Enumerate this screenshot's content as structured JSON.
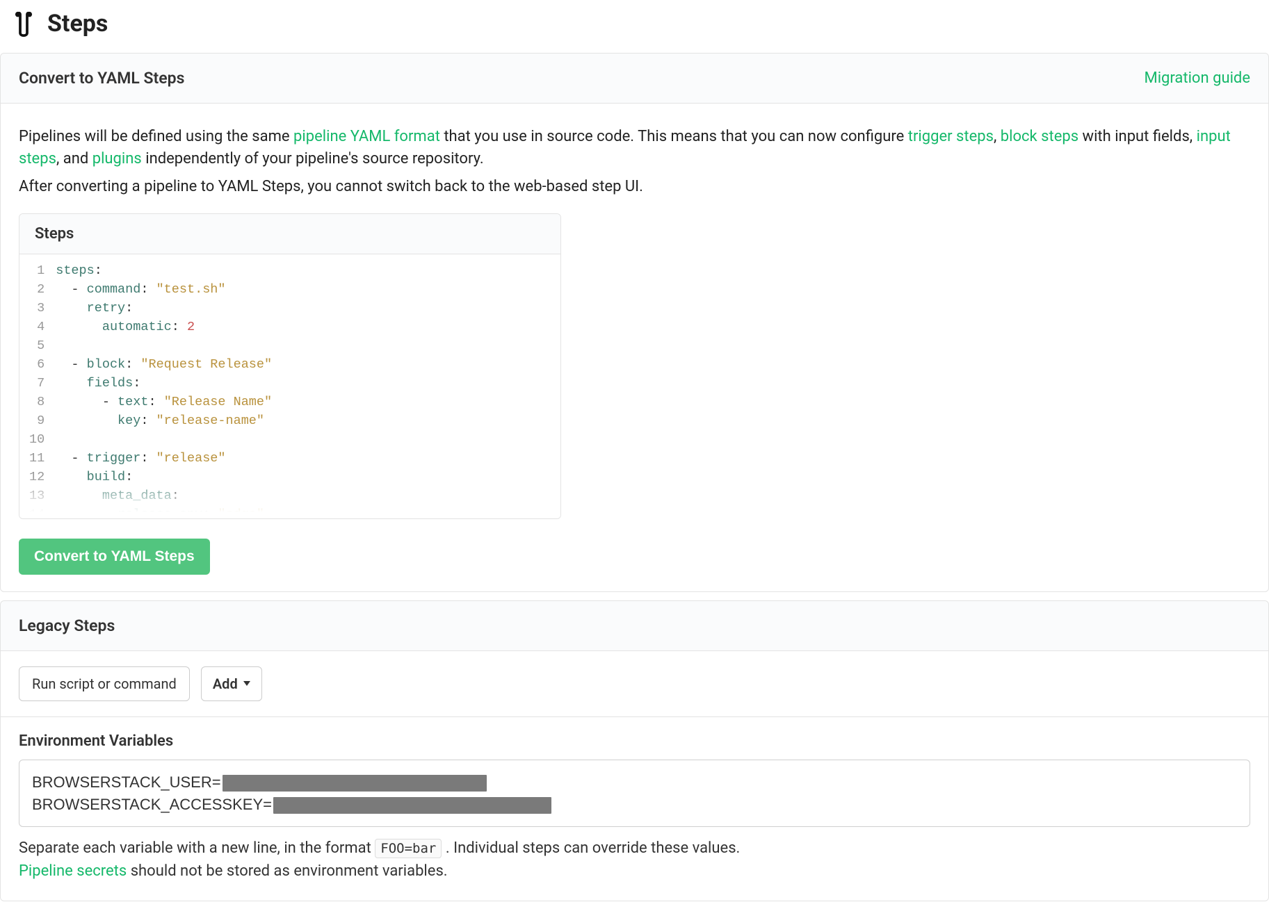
{
  "page_title": "Steps",
  "convert_panel": {
    "title": "Convert to YAML Steps",
    "migration_link": "Migration guide",
    "intro": {
      "pre": "Pipelines will be defined using the same ",
      "link1": "pipeline YAML format",
      "mid1": " that you use in source code. This means that you can now configure ",
      "link2": "trigger steps",
      "sep1": ", ",
      "link3": "block steps",
      "mid2": " with input fields, ",
      "link4": "input steps",
      "mid3": ", and ",
      "link5": "plugins",
      "post": " independently of your pipeline's source repository."
    },
    "warning": "After converting a pipeline to YAML Steps, you cannot switch back to the web-based step UI.",
    "code_title": "Steps",
    "code_lines": [
      "steps:",
      "  - command: \"test.sh\"",
      "    retry:",
      "      automatic: 2",
      "",
      "  - block: \"Request Release\"",
      "    fields:",
      "      - text: \"Release Name\"",
      "        key: \"release-name\"",
      "",
      "  - trigger: \"release\"",
      "    build:",
      "      meta_data:",
      "        release-env: \"edge\""
    ],
    "button": "Convert to YAML Steps"
  },
  "legacy_panel": {
    "title": "Legacy Steps",
    "step_chip": "Run script or command",
    "add_label": "Add",
    "env": {
      "title": "Environment Variables",
      "var1_name": "BROWSERSTACK_USER=",
      "var1_redacted_width": 380,
      "var2_name": "BROWSERSTACK_ACCESSKEY=",
      "var2_redacted_width": 400,
      "hint_pre": "Separate each variable with a new line, in the format ",
      "hint_code": "FOO=bar",
      "hint_post": ". Individual steps can override these values.",
      "secrets_link": "Pipeline secrets",
      "secrets_post": " should not be stored as environment variables."
    }
  }
}
